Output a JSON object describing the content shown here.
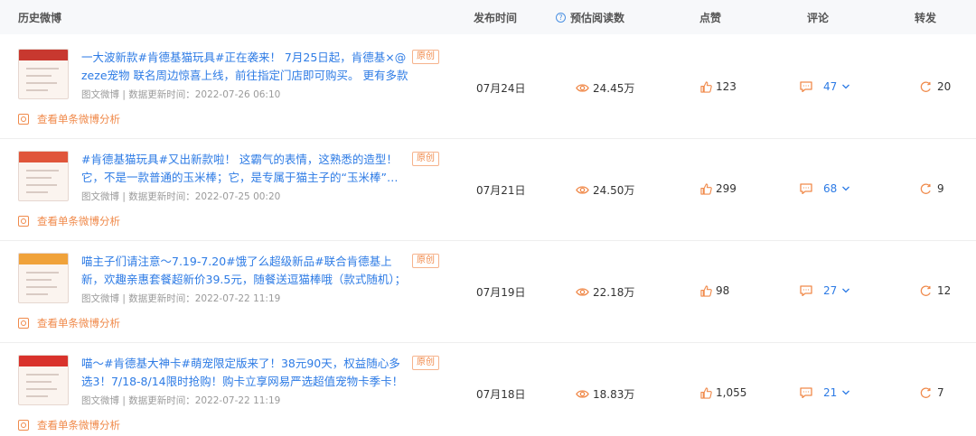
{
  "header": {
    "title": "历史微博",
    "publish_time": "发布时间",
    "estimated_reads": "预估阅读数",
    "likes": "点赞",
    "comments": "评论",
    "reposts": "转发"
  },
  "posts": [
    {
      "text": "一大波新款#肯德基猫玩具#正在袭来！ 7月25日起，肯德基×@zeze宠物 联名周边惊喜上线，前往指定门店即可购买。 更有多款K…",
      "tag": "原创",
      "meta": "图文微博 | 数据更新时间：2022-07-26 06:10",
      "analysis": "查看单条微博分析",
      "date": "07月24日",
      "views": "24.45万",
      "likes": "123",
      "comments": "47",
      "reposts": "20",
      "thumb_color": "#c8382f"
    },
    {
      "text": "#肯德基猫玩具#又出新款啦！ 这霸气的表情，这熟悉的造型！ 它，不是一款普通的玉米棒；它，是专属于猫主子的“玉米棒”…",
      "tag": "原创",
      "meta": "图文微博 | 数据更新时间：2022-07-25 00:20",
      "analysis": "查看单条微博分析",
      "date": "07月21日",
      "views": "24.50万",
      "likes": "299",
      "comments": "68",
      "reposts": "9",
      "thumb_color": "#e0553a"
    },
    {
      "text": "喵主子们请注意～7.19-7.20#饿了么超级新品#联合肯德基上新，欢趣亲惠套餐超新价39.5元，随餐送逗猫棒哦（款式随机）；乐…",
      "tag": "原创",
      "meta": "图文微博 | 数据更新时间：2022-07-22 11:19",
      "analysis": "查看单条微博分析",
      "date": "07月19日",
      "views": "22.18万",
      "likes": "98",
      "comments": "27",
      "reposts": "12",
      "thumb_color": "#f0a23a"
    },
    {
      "text": "喵～#肯德基大神卡#萌宠限定版来了！38元90天，权益随心多选3！7/18-8/14限时抢购！购卡立享网易严选超值宠物卡季卡！购…",
      "tag": "原创",
      "meta": "图文微博 | 数据更新时间：2022-07-22 11:19",
      "analysis": "查看单条微博分析",
      "date": "07月18日",
      "views": "18.83万",
      "likes": "1,055",
      "comments": "21",
      "reposts": "7",
      "thumb_color": "#d9322c"
    }
  ]
}
